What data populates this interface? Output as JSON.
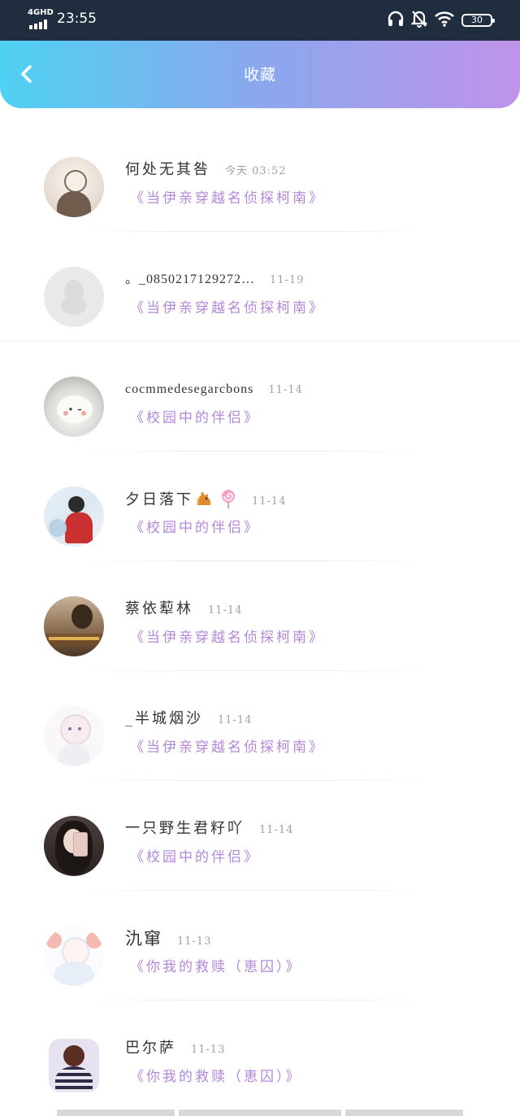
{
  "status_bar": {
    "network": "4GHD",
    "time": "23:55",
    "battery": "30",
    "icons": [
      "headphones-icon",
      "bell-muted-icon",
      "wifi-icon",
      "battery-icon"
    ]
  },
  "header": {
    "title": "收藏",
    "back_icon": "chevron-left-icon",
    "gradient": [
      "#4fd1f2",
      "#8ba7ee",
      "#bf93ea"
    ]
  },
  "colors": {
    "accent_purple": "#b287d9",
    "timestamp_gray": "#a0a0a0",
    "name_text": "#333333"
  },
  "items": [
    {
      "nickname": "何处无其咎",
      "time": "今天 03:52",
      "book": "《当伊亲穿越名侦探柯南》"
    },
    {
      "nickname": "。_0850217129272…",
      "time": "11-19",
      "book": "《当伊亲穿越名侦探柯南》"
    },
    {
      "nickname": "cocmmedesegarcbons",
      "time": "11-14",
      "book": "《校园中的伴侣》"
    },
    {
      "nickname": "夕日落下",
      "time": "11-14",
      "book": "《校园中的伴侣》"
    },
    {
      "nickname": "蔡依䔣林",
      "time": "11-14",
      "book": "《当伊亲穿越名侦探柯南》"
    },
    {
      "nickname": "_半城烟沙",
      "time": "11-14",
      "book": "《当伊亲穿越名侦探柯南》"
    },
    {
      "nickname": "一只野生君籽吖",
      "time": "11-14",
      "book": "《校园中的伴侣》"
    },
    {
      "nickname": "氿窜",
      "time": "11-13",
      "book": "《你我的救赎（恵囚）》"
    },
    {
      "nickname": "巴尔萨",
      "time": "11-13",
      "book": "《你我的救赎（恵囚）》"
    }
  ]
}
